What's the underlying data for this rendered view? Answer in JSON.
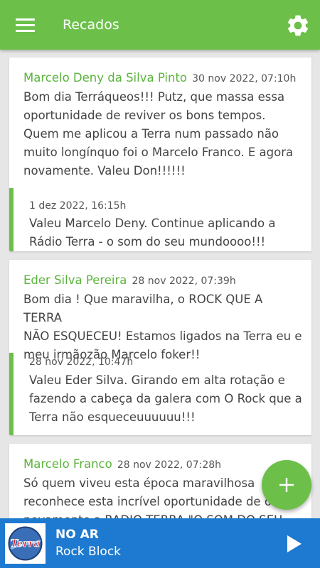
{
  "appbar": {
    "title": "Recados",
    "menu_icon": "hamburger-menu-icon",
    "settings_icon": "gear-icon"
  },
  "colors": {
    "brand_green": "#6cc04a",
    "author_green": "#5bb33c",
    "player_blue": "#1e7ad0",
    "background": "#e6e6e6"
  },
  "messages": [
    {
      "author": "Marcelo Deny da Silva Pinto",
      "date": "30 nov 2022, 07:10h",
      "lines": [
        "Bom dia Terráqueos!!! Putz, que massa essa",
        "oportunidade de reviver os bons tempos.",
        "Quem me aplicou a Terra num passado não",
        "muito longínquo foi o Marcelo Franco. E agora",
        "novamente.  Valeu Don!!!!!!"
      ],
      "reply": {
        "date": "1 dez 2022, 16:15h",
        "lines": [
          "Valeu Marcelo Deny. Continue aplicando a",
          "Rádio Terra - o som do seu mundoooo!!!"
        ]
      }
    },
    {
      "author": "Eder Silva Pereira",
      "date": "28 nov 2022, 07:39h",
      "lines": [
        "Bom dia ! Que maravilha, o ROCK QUE A TERRA",
        "NÃO ESQUECEU! Estamos ligados na Terra eu e",
        "meu irmãozão Marcelo foker!!"
      ],
      "reply": {
        "date": "28 nov 2022, 10:47h",
        "lines": [
          "Valeu Eder Silva. Girando em alta rotação e",
          "fazendo a cabeça da galera com O Rock que a",
          "Terra não esqueceuuuuuu!!!"
        ]
      }
    },
    {
      "author": "Marcelo Franco",
      "date": "28 nov 2022, 07:28h",
      "lines": [
        "Só quem viveu esta época maravilhosa",
        "reconhece esta incrível oportunidade de ouvir",
        "novamente a RADIO TERRA \"O SOM DO SEU"
      ]
    }
  ],
  "fab": {
    "icon": "plus-icon"
  },
  "player": {
    "logo_text": "Terra",
    "status": "NO AR",
    "show": "Rock Block",
    "play_icon": "play-icon"
  }
}
